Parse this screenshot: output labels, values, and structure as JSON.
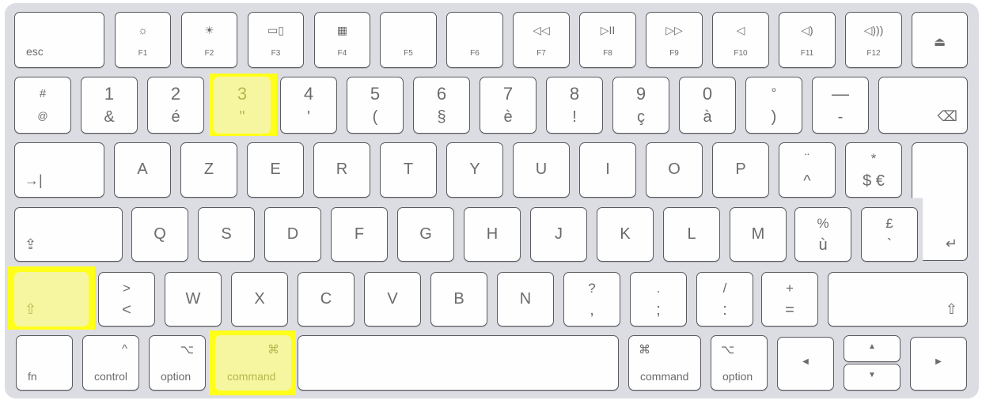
{
  "keyboard": {
    "layout": "French AZERTY Magic Keyboard",
    "highlight_color": "#ffff1a",
    "highlighted_keys": [
      "3",
      "shift-left",
      "command-left"
    ],
    "rows": [
      [
        {
          "id": "esc",
          "mod": "esc"
        },
        {
          "id": "f1",
          "icon": "☼",
          "fn": "F1",
          "icon_name": "brightness-down-icon"
        },
        {
          "id": "f2",
          "icon": "☀",
          "fn": "F2",
          "icon_name": "brightness-up-icon"
        },
        {
          "id": "f3",
          "icon": "▭▯",
          "fn": "F3",
          "icon_name": "mission-control-icon"
        },
        {
          "id": "f4",
          "icon": "▦",
          "fn": "F4",
          "icon_name": "launchpad-icon"
        },
        {
          "id": "f5",
          "icon": "",
          "fn": "F5"
        },
        {
          "id": "f6",
          "icon": "",
          "fn": "F6"
        },
        {
          "id": "f7",
          "icon": "◁◁",
          "fn": "F7",
          "icon_name": "rewind-icon"
        },
        {
          "id": "f8",
          "icon": "▷II",
          "fn": "F8",
          "icon_name": "play-pause-icon"
        },
        {
          "id": "f9",
          "icon": "▷▷",
          "fn": "F9",
          "icon_name": "fast-forward-icon"
        },
        {
          "id": "f10",
          "icon": "◁",
          "fn": "F10",
          "icon_name": "mute-icon"
        },
        {
          "id": "f11",
          "icon": "◁)",
          "fn": "F11",
          "icon_name": "volume-down-icon"
        },
        {
          "id": "f12",
          "icon": "◁)))",
          "fn": "F12",
          "icon_name": "volume-up-icon"
        },
        {
          "id": "eject",
          "center": "⏏",
          "icon_name": "eject-icon"
        }
      ],
      [
        {
          "id": "hash",
          "top": "#",
          "bottom": "@",
          "smallTop": true
        },
        {
          "id": "1",
          "top": "1",
          "bottom": "&"
        },
        {
          "id": "2",
          "top": "2",
          "bottom": "é"
        },
        {
          "id": "3",
          "top": "3",
          "bottom": "\""
        },
        {
          "id": "4",
          "top": "4",
          "bottom": "'"
        },
        {
          "id": "5",
          "top": "5",
          "bottom": "("
        },
        {
          "id": "6",
          "top": "6",
          "bottom": "§"
        },
        {
          "id": "7",
          "top": "7",
          "bottom": "è"
        },
        {
          "id": "8",
          "top": "8",
          "bottom": "!"
        },
        {
          "id": "9",
          "top": "9",
          "bottom": "ç"
        },
        {
          "id": "0",
          "top": "0",
          "bottom": "à"
        },
        {
          "id": "degree",
          "top": "°",
          "bottom": ")"
        },
        {
          "id": "underscore",
          "top": "—",
          "bottom": "-"
        },
        {
          "id": "delete",
          "br": "⌫",
          "icon_name": "delete-icon"
        }
      ],
      [
        {
          "id": "tab",
          "bl": "→|",
          "icon_name": "tab-icon"
        },
        {
          "id": "a",
          "letter": "A"
        },
        {
          "id": "z",
          "letter": "Z"
        },
        {
          "id": "e",
          "letter": "E"
        },
        {
          "id": "r",
          "letter": "R"
        },
        {
          "id": "t",
          "letter": "T"
        },
        {
          "id": "y",
          "letter": "Y"
        },
        {
          "id": "u",
          "letter": "U"
        },
        {
          "id": "i",
          "letter": "I"
        },
        {
          "id": "o",
          "letter": "O"
        },
        {
          "id": "p",
          "letter": "P"
        },
        {
          "id": "circumflex",
          "top": "¨",
          "bottom": "^"
        },
        {
          "id": "dollar",
          "top": "*",
          "bottom": "$ €"
        },
        {
          "id": "return",
          "br": "↵",
          "icon_name": "return-icon"
        }
      ],
      [
        {
          "id": "caps-lock",
          "bl": "⇪",
          "icon_name": "caps-lock-icon"
        },
        {
          "id": "q",
          "letter": "Q"
        },
        {
          "id": "s",
          "letter": "S"
        },
        {
          "id": "d",
          "letter": "D"
        },
        {
          "id": "f",
          "letter": "F"
        },
        {
          "id": "g",
          "letter": "G"
        },
        {
          "id": "h",
          "letter": "H"
        },
        {
          "id": "j",
          "letter": "J"
        },
        {
          "id": "k",
          "letter": "K"
        },
        {
          "id": "l",
          "letter": "L"
        },
        {
          "id": "m",
          "letter": "M"
        },
        {
          "id": "percent",
          "top": "%",
          "bottom": "ù"
        },
        {
          "id": "pound",
          "top": "£",
          "bottom": "`"
        }
      ],
      [
        {
          "id": "shift-left",
          "bl": "⇧",
          "icon_name": "shift-icon"
        },
        {
          "id": "angle",
          "top": ">",
          "bottom": "<"
        },
        {
          "id": "w",
          "letter": "W"
        },
        {
          "id": "x",
          "letter": "X"
        },
        {
          "id": "c",
          "letter": "C"
        },
        {
          "id": "v",
          "letter": "V"
        },
        {
          "id": "b",
          "letter": "B"
        },
        {
          "id": "n",
          "letter": "N"
        },
        {
          "id": "comma",
          "top": "?",
          "bottom": ","
        },
        {
          "id": "semicolon",
          "top": ".",
          "bottom": ";"
        },
        {
          "id": "colon",
          "top": "/",
          "bottom": ":"
        },
        {
          "id": "equals",
          "top": "+",
          "bottom": "="
        },
        {
          "id": "shift-right",
          "br": "⇧",
          "icon_name": "shift-icon"
        }
      ],
      [
        {
          "id": "fn",
          "mod": "fn"
        },
        {
          "id": "control-left",
          "mod": "control",
          "tr": "^"
        },
        {
          "id": "option-left",
          "mod": "option",
          "tr": "⌥"
        },
        {
          "id": "command-left",
          "mod": "command",
          "tr": "⌘"
        },
        {
          "id": "space"
        },
        {
          "id": "command-right",
          "mod": "command",
          "tl": "⌘"
        },
        {
          "id": "option-right",
          "mod": "option",
          "tl": "⌥"
        },
        {
          "id": "arrow-left",
          "center": "◀",
          "icon_name": "arrow-left-icon"
        },
        {
          "id": "arrow-up",
          "center": "▲",
          "icon_name": "arrow-up-icon"
        },
        {
          "id": "arrow-down",
          "center": "▼",
          "icon_name": "arrow-down-icon"
        },
        {
          "id": "arrow-right",
          "center": "▶",
          "icon_name": "arrow-right-icon"
        }
      ]
    ]
  }
}
